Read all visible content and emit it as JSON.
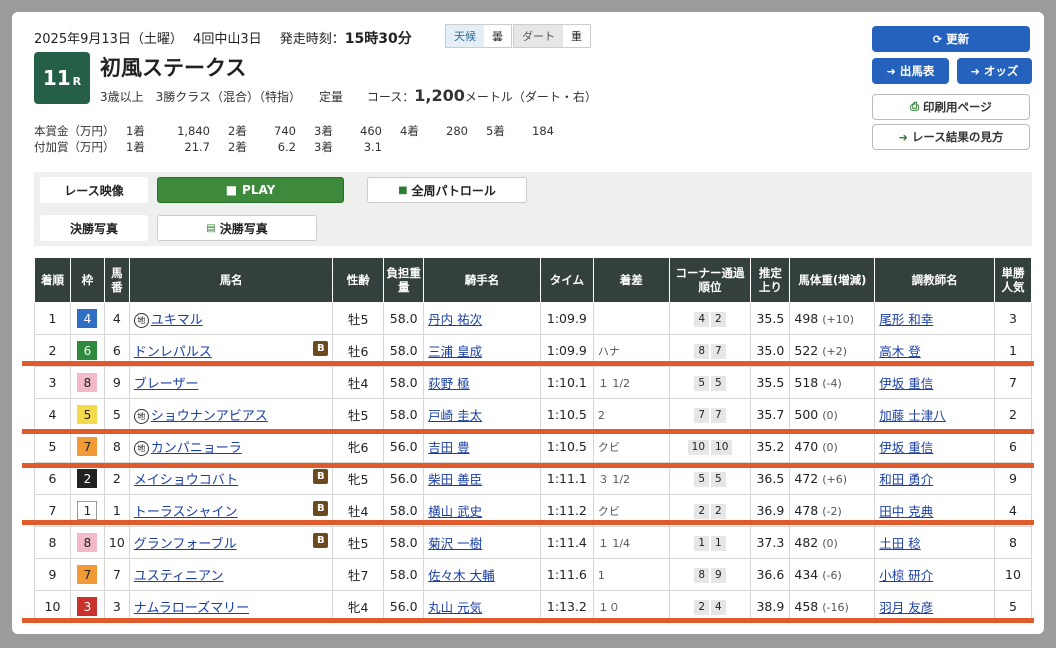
{
  "header": {
    "date": "2025年9月13日（土曜）",
    "meeting": "4回中山3日",
    "post_time_label": "発走時刻：",
    "post_time": "15時30分",
    "weather_label": "天候",
    "weather": "曇",
    "surface_label": "ダート",
    "surface_state": "重",
    "race_no": "11",
    "race_no_suffix": "R",
    "race_name": "初風ステークス",
    "conditions": "3歳以上　3勝クラス（混合）（特指）　　定量",
    "course_label": "コース：",
    "distance": "1,200",
    "course_unit": "メートル（ダート・右）"
  },
  "prize": {
    "main_label": "本賞金（万円）",
    "main": [
      [
        "1着",
        "1,840"
      ],
      [
        "2着",
        "740"
      ],
      [
        "3着",
        "460"
      ],
      [
        "4着",
        "280"
      ],
      [
        "5着",
        "184"
      ]
    ],
    "add_label": "付加賞（万円）",
    "add": [
      [
        "1着",
        "21.7"
      ],
      [
        "2着",
        "6.2"
      ],
      [
        "3着",
        "3.1"
      ]
    ]
  },
  "buttons": {
    "update": "更新",
    "entries": "出馬表",
    "odds": "オッズ",
    "print": "印刷用ページ",
    "howto": "レース結果の見方"
  },
  "media": {
    "video_label": "レース映像",
    "play": "PLAY",
    "patrol": "全周パトロール",
    "photo_label": "決勝写真",
    "photo_btn": "決勝写真"
  },
  "table": {
    "headers": [
      "着順",
      "枠",
      "馬番",
      "馬名",
      "性齢",
      "負担重量",
      "騎手名",
      "タイム",
      "着差",
      "コーナー通過順位",
      "推定上り",
      "馬体重(増減)",
      "調教師名",
      "単勝人気"
    ],
    "rows": [
      {
        "pos": "1",
        "waku": "4",
        "num": "4",
        "mark": "地",
        "name": "ユキマル",
        "blinker": "",
        "sex": "牡5",
        "wt": "58.0",
        "jockey": "丹内 祐次",
        "time": "1:09.9",
        "margin": "",
        "c1": "4",
        "c2": "2",
        "last": "35.5",
        "bw": "498",
        "bwd": "(+10)",
        "trainer": "尾形 和幸",
        "pop": "3"
      },
      {
        "pos": "2",
        "waku": "6",
        "num": "6",
        "mark": "",
        "name": "ドンレパルス",
        "blinker": "B",
        "sex": "牡6",
        "wt": "58.0",
        "jockey": "三浦 皇成",
        "time": "1:09.9",
        "margin": "ハナ",
        "c1": "8",
        "c2": "7",
        "last": "35.0",
        "bw": "522",
        "bwd": "(+2)",
        "trainer": "高木 登",
        "pop": "1"
      },
      {
        "pos": "3",
        "waku": "8",
        "num": "9",
        "mark": "",
        "name": "ブレーザー",
        "blinker": "",
        "sex": "牡4",
        "wt": "58.0",
        "jockey": "荻野 極",
        "time": "1:10.1",
        "margin": "１ 1/2",
        "c1": "5",
        "c2": "5",
        "last": "35.5",
        "bw": "518",
        "bwd": "(-4)",
        "trainer": "伊坂 重信",
        "pop": "7"
      },
      {
        "pos": "4",
        "waku": "5",
        "num": "5",
        "mark": "地",
        "name": "ショウナンアビアス",
        "blinker": "",
        "sex": "牡5",
        "wt": "58.0",
        "jockey": "戸崎 圭太",
        "time": "1:10.5",
        "margin": "2",
        "c1": "7",
        "c2": "7",
        "last": "35.7",
        "bw": "500",
        "bwd": "(0)",
        "trainer": "加藤 士津八",
        "pop": "2"
      },
      {
        "pos": "5",
        "waku": "7",
        "num": "8",
        "mark": "地",
        "name": "カンパニョーラ",
        "blinker": "",
        "sex": "牝6",
        "wt": "56.0",
        "jockey": "吉田 豊",
        "time": "1:10.5",
        "margin": "クビ",
        "c1": "10",
        "c2": "10",
        "last": "35.2",
        "bw": "470",
        "bwd": "(0)",
        "trainer": "伊坂 重信",
        "pop": "6"
      },
      {
        "pos": "6",
        "waku": "2",
        "num": "2",
        "mark": "",
        "name": "メイショウコバト",
        "blinker": "B",
        "sex": "牝5",
        "wt": "56.0",
        "jockey": "柴田 善臣",
        "time": "1:11.1",
        "margin": "３ 1/2",
        "c1": "5",
        "c2": "5",
        "last": "36.5",
        "bw": "472",
        "bwd": "(+6)",
        "trainer": "和田 勇介",
        "pop": "9"
      },
      {
        "pos": "7",
        "waku": "1",
        "num": "1",
        "mark": "",
        "name": "トーラスシャイン",
        "blinker": "B",
        "sex": "牡4",
        "wt": "58.0",
        "jockey": "横山 武史",
        "time": "1:11.2",
        "margin": "クビ",
        "c1": "2",
        "c2": "2",
        "last": "36.9",
        "bw": "478",
        "bwd": "(-2)",
        "trainer": "田中 克典",
        "pop": "4"
      },
      {
        "pos": "8",
        "waku": "8",
        "num": "10",
        "mark": "",
        "name": "グランフォーブル",
        "blinker": "B",
        "sex": "牡5",
        "wt": "58.0",
        "jockey": "菊沢 一樹",
        "time": "1:11.4",
        "margin": "１ 1/4",
        "c1": "1",
        "c2": "1",
        "last": "37.3",
        "bw": "482",
        "bwd": "(0)",
        "trainer": "土田 稔",
        "pop": "8"
      },
      {
        "pos": "9",
        "waku": "7",
        "num": "7",
        "mark": "",
        "name": "ユスティニアン",
        "blinker": "",
        "sex": "牡7",
        "wt": "58.0",
        "jockey": "佐々木 大輔",
        "time": "1:11.6",
        "margin": "1",
        "c1": "8",
        "c2": "9",
        "last": "36.6",
        "bw": "434",
        "bwd": "(-6)",
        "trainer": "小椋 研介",
        "pop": "10"
      },
      {
        "pos": "10",
        "waku": "3",
        "num": "3",
        "mark": "",
        "name": "ナムラローズマリー",
        "blinker": "",
        "sex": "牝4",
        "wt": "56.0",
        "jockey": "丸山 元気",
        "time": "1:13.2",
        "margin": "１０",
        "c1": "2",
        "c2": "4",
        "last": "38.9",
        "bw": "458",
        "bwd": "(-16)",
        "trainer": "羽月 友彦",
        "pop": "5"
      }
    ]
  },
  "colors": {
    "waku1": "#ffffff",
    "waku2": "#222222",
    "waku3": "#c8322b",
    "waku4": "#2e6fc4",
    "waku5": "#f4d94a",
    "waku6": "#2e8b3e",
    "waku7": "#f29a35",
    "waku8": "#f3b9c7",
    "accent": "#2462bd",
    "header_bg": "#33403d",
    "mark_line": "#e05a2b"
  }
}
